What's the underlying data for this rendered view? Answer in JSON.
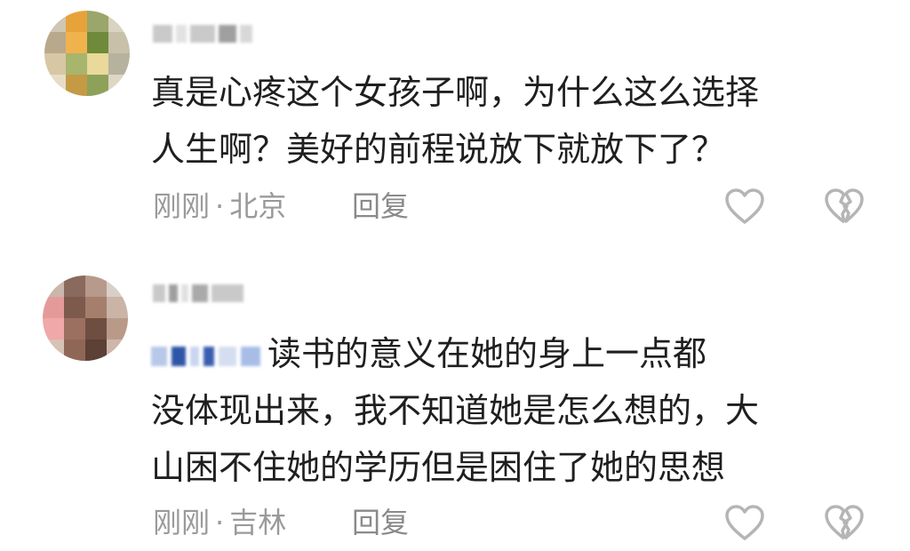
{
  "comments": [
    {
      "text_lines": [
        "真是心疼这个女孩子啊，为什么这么选择",
        "人生啊？美好的前程说放下就放下了？"
      ],
      "time": "刚刚",
      "separator": "·",
      "location": "北京",
      "reply_label": "回复",
      "like_icon": "heart-outline-icon",
      "dislike_icon": "broken-heart-icon"
    },
    {
      "text_lines": [
        "读书的意义在她的身上一点都",
        "没体现出来，我不知道她是怎么想的，大",
        "山困不住她的学历但是困住了她的思想"
      ],
      "time": "刚刚",
      "separator": "·",
      "location": "吉林",
      "reply_label": "回复",
      "like_icon": "heart-outline-icon",
      "dislike_icon": "broken-heart-icon"
    }
  ],
  "colors": {
    "text": "#1f1f1f",
    "meta": "#9a9a9a",
    "icon": "#b5b5b5",
    "mention_blue": "#3b6fd8"
  }
}
